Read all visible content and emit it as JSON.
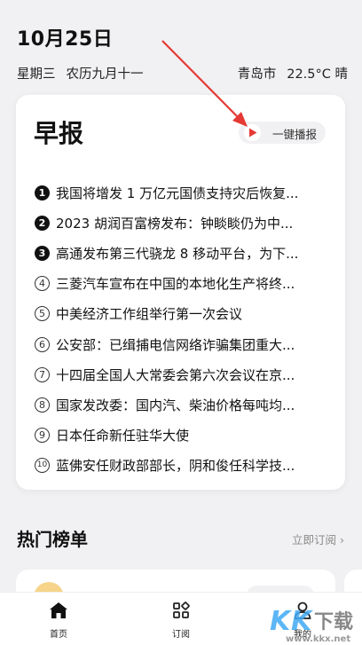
{
  "header": {
    "date": "10月25日",
    "weekday": "星期三",
    "lunar": "农历九月十一",
    "city": "青岛市",
    "weather": "22.5°C 晴"
  },
  "briefing": {
    "title": "早报",
    "play_label": "一键播报",
    "items": [
      {
        "num": "1",
        "text": "我国将增发 1 万亿元国债支持灾后恢复..."
      },
      {
        "num": "2",
        "text": "2023 胡润百富榜发布：钟睒睒仍为中..."
      },
      {
        "num": "3",
        "text": "高通发布第三代骁龙 8 移动平台，为下..."
      },
      {
        "num": "4",
        "text": "三菱汽车宣布在中国的本地化生产将终..."
      },
      {
        "num": "5",
        "text": "中美经济工作组举行第一次会议"
      },
      {
        "num": "6",
        "text": "公安部：已缉捕电信网络诈骗集团重大..."
      },
      {
        "num": "7",
        "text": "十四届全国人大常委会第六次会议在京..."
      },
      {
        "num": "8",
        "text": "国家发改委：国内汽、柴油价格每吨均..."
      },
      {
        "num": "9",
        "text": "日本任命新任驻华大使"
      },
      {
        "num": "10",
        "text": "蓝佛安任财政部部长，阴和俊任科学技..."
      }
    ]
  },
  "hot_list": {
    "title": "热门榜单",
    "link_label": "立即订阅 ›"
  },
  "tabbar": {
    "tabs": [
      {
        "label": "首页",
        "icon": "home-icon"
      },
      {
        "label": "订阅",
        "icon": "grid-icon"
      },
      {
        "label": "我的",
        "icon": "person-icon"
      }
    ]
  },
  "watermark": {
    "domain": "www.kkx.net"
  },
  "colors": {
    "background": "#f1f1f3",
    "play_accent": "#e53935",
    "annotation_arrow": "#e53935"
  }
}
